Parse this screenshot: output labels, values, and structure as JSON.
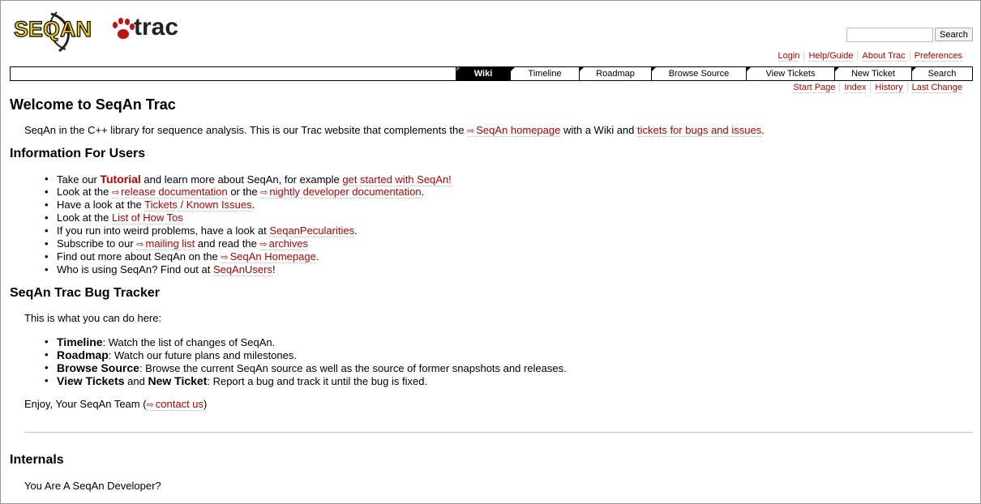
{
  "logo": {
    "text_a": "SEQAN",
    "text_b": "trac"
  },
  "search": {
    "placeholder": "",
    "button": "Search"
  },
  "metanav": [
    "Login",
    "Help/Guide",
    "About Trac",
    "Preferences"
  ],
  "mainnav": [
    {
      "label": "Wiki",
      "active": true
    },
    {
      "label": "Timeline",
      "active": false
    },
    {
      "label": "Roadmap",
      "active": false
    },
    {
      "label": "Browse Source",
      "active": false
    },
    {
      "label": "View Tickets",
      "active": false
    },
    {
      "label": "New Ticket",
      "active": false
    },
    {
      "label": "Search",
      "active": false
    }
  ],
  "ctxtnav": [
    "Start Page",
    "Index",
    "History",
    "Last Change"
  ],
  "page": {
    "title": "Welcome to SeqAn Trac",
    "intro": {
      "a": "SeqAn in the C++ library for sequence analysis. This is our Trac website that complements the ",
      "link1": "SeqAn homepage",
      "b": " with a Wiki and ",
      "link2": "tickets for bugs and issues",
      "c": "."
    },
    "users_heading": "Information For Users",
    "users": [
      {
        "a": "Take our ",
        "link": "Tutorial",
        "b": " and learn more about SeqAn, for example ",
        "link2": "get started with SeqAn!",
        "c": ""
      },
      {
        "a": "Look at the ",
        "link": "release documentation",
        "b": " or the ",
        "link2": "nightly developer documentation",
        "c": "."
      },
      {
        "a": "Have a look at the ",
        "link": "Tickets / Known Issues",
        "b": ".",
        "link2": "",
        "c": ""
      },
      {
        "a": "Look at the ",
        "link": "List of How Tos",
        "b": "",
        "link2": "",
        "c": ""
      },
      {
        "a": "If you run into weird problems, have a look at ",
        "link": "SeqanPecularities",
        "b": ".",
        "link2": "",
        "c": ""
      },
      {
        "a": "Subscribe to our ",
        "link": "mailing list",
        "b": " and read the ",
        "link2": "archives",
        "c": ""
      },
      {
        "a": "Find out more about SeqAn on the ",
        "link": "SeqAn Homepage",
        "b": ".",
        "link2": "",
        "c": ""
      },
      {
        "a": "Who is using SeqAn? Find out at ",
        "link": "SeqAnUsers",
        "b": "!",
        "link2": "",
        "c": ""
      }
    ],
    "tracker_heading": "SeqAn Trac Bug Tracker",
    "tracker_intro": "This is what you can do here:",
    "tracker": [
      {
        "term": "Timeline",
        "text": ": Watch the list of changes of SeqAn."
      },
      {
        "term": "Roadmap",
        "text": ": Watch our future plans and milestones."
      },
      {
        "term": "Browse Source",
        "text": ": Browse the current SeqAn source as well as the source of former snapshots and releases."
      },
      {
        "term": "View Tickets",
        "mid": " and ",
        "term2": "New Ticket",
        "text": ": Report a bug and track it until the bug is fixed."
      }
    ],
    "enjoy": {
      "a": "Enjoy, Your SeqAn Team (",
      "link": "contact us",
      "b": ")"
    },
    "internals_heading": "Internals",
    "internals_text": "You Are A SeqAn Developer?"
  }
}
